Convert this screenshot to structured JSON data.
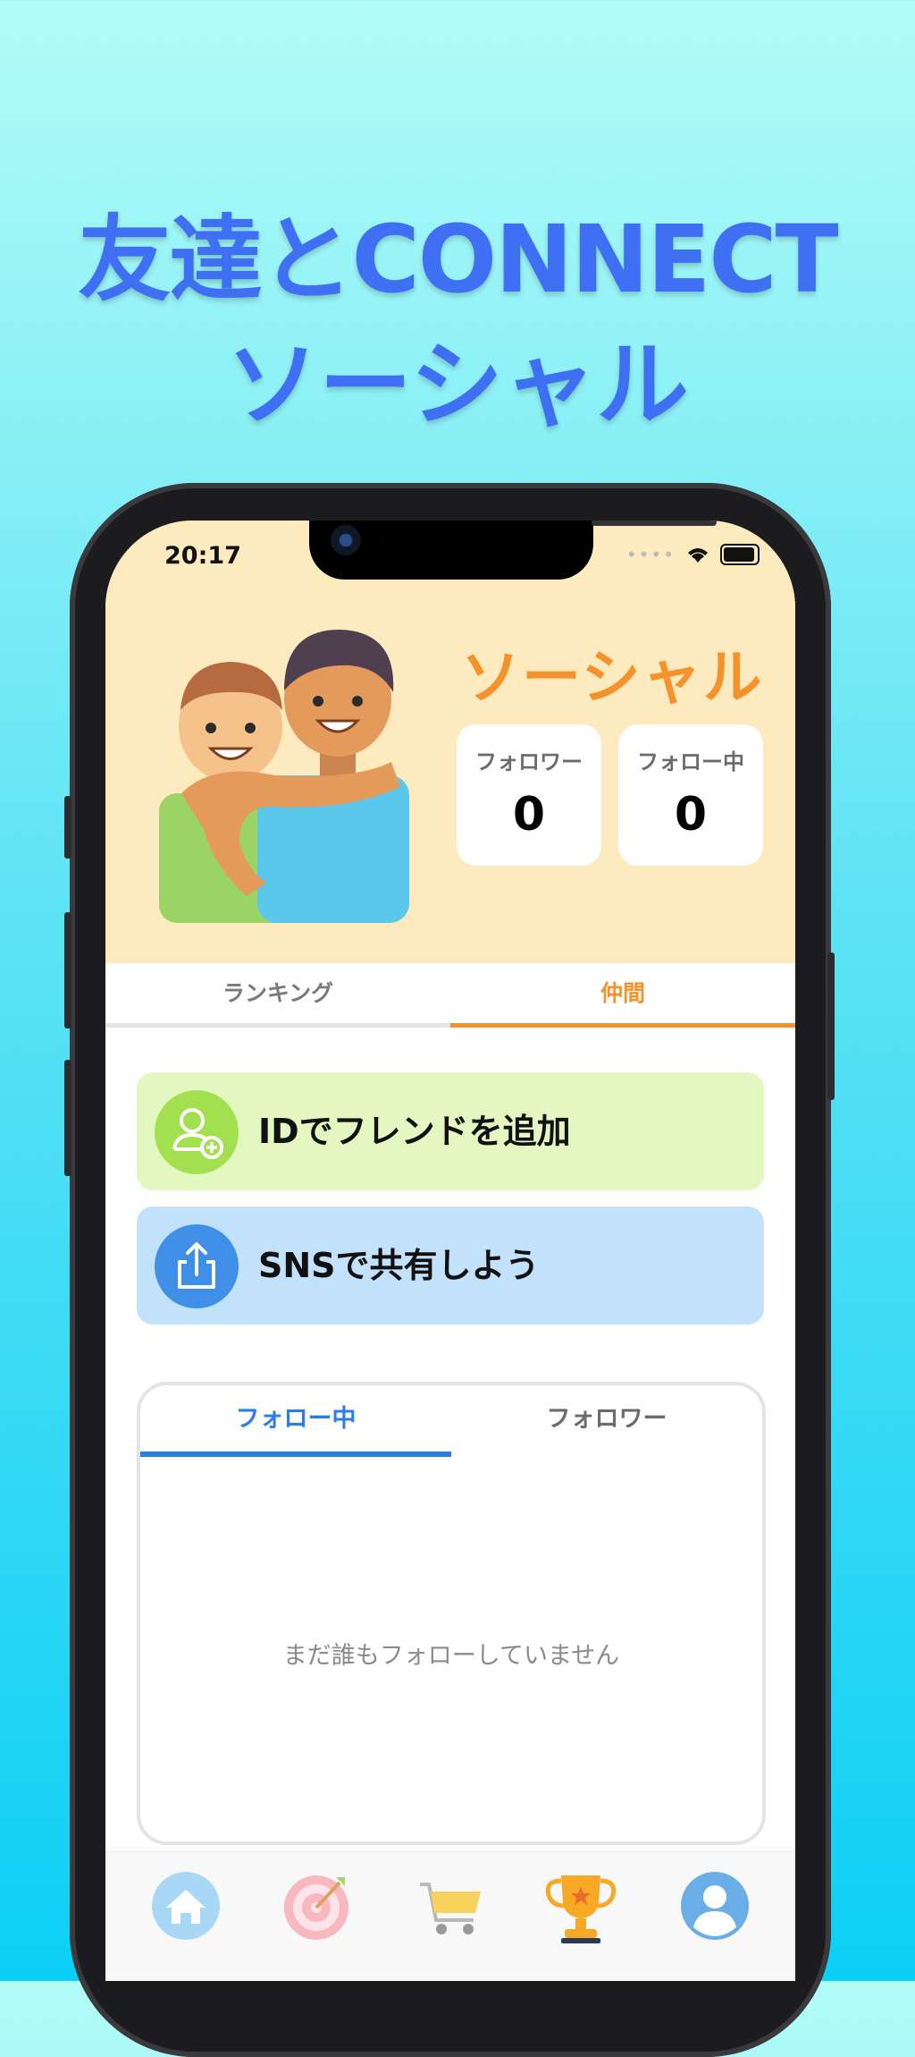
{
  "headline": {
    "line1": "友達とCONNECT",
    "line2": "ソーシャル"
  },
  "status_bar": {
    "time": "20:17"
  },
  "header": {
    "title": "ソーシャル",
    "followers_label": "フォロワー",
    "followers_count": "0",
    "following_label": "フォロー中",
    "following_count": "0"
  },
  "top_tabs": [
    {
      "label": "ランキング",
      "active": false
    },
    {
      "label": "仲間",
      "active": true
    }
  ],
  "actions": {
    "add_friend_label": "IDでフレンドを追加",
    "share_label": "SNSで共有しよう"
  },
  "follow_tabs": [
    {
      "label": "フォロー中",
      "active": true
    },
    {
      "label": "フォロワー",
      "active": false
    }
  ],
  "empty_message": "まだ誰もフォローしていません",
  "bottom_nav": [
    {
      "icon": "home-icon"
    },
    {
      "icon": "target-icon"
    },
    {
      "icon": "cart-icon"
    },
    {
      "icon": "trophy-icon",
      "active": true
    },
    {
      "icon": "profile-icon"
    }
  ],
  "colors": {
    "accent_orange": "#f5922c",
    "accent_blue": "#2a7ee8",
    "header_bg": "#fdebbf",
    "add_friend_bg": "#e2f8c0",
    "share_bg": "#c2e2fb",
    "headline": "#3f6ff2"
  }
}
